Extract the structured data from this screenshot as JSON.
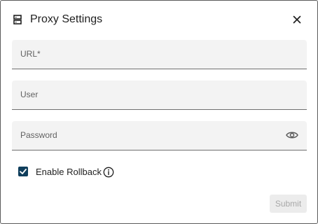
{
  "dialog": {
    "title": "Proxy Settings",
    "title_icon": "server-icon",
    "close_icon": "close-icon"
  },
  "fields": {
    "url": {
      "label": "URL*",
      "value": ""
    },
    "user": {
      "label": "User",
      "value": ""
    },
    "password": {
      "label": "Password",
      "value": "",
      "toggle_icon": "eye-icon"
    }
  },
  "rollback": {
    "label": "Enable Rollback",
    "checked": true,
    "info_icon": "info-icon"
  },
  "actions": {
    "submit_label": "Submit",
    "submit_enabled": false
  },
  "colors": {
    "checkbox": "#0f3e5c",
    "field_background": "#f3f3f3",
    "disabled_button": "#ececec"
  }
}
